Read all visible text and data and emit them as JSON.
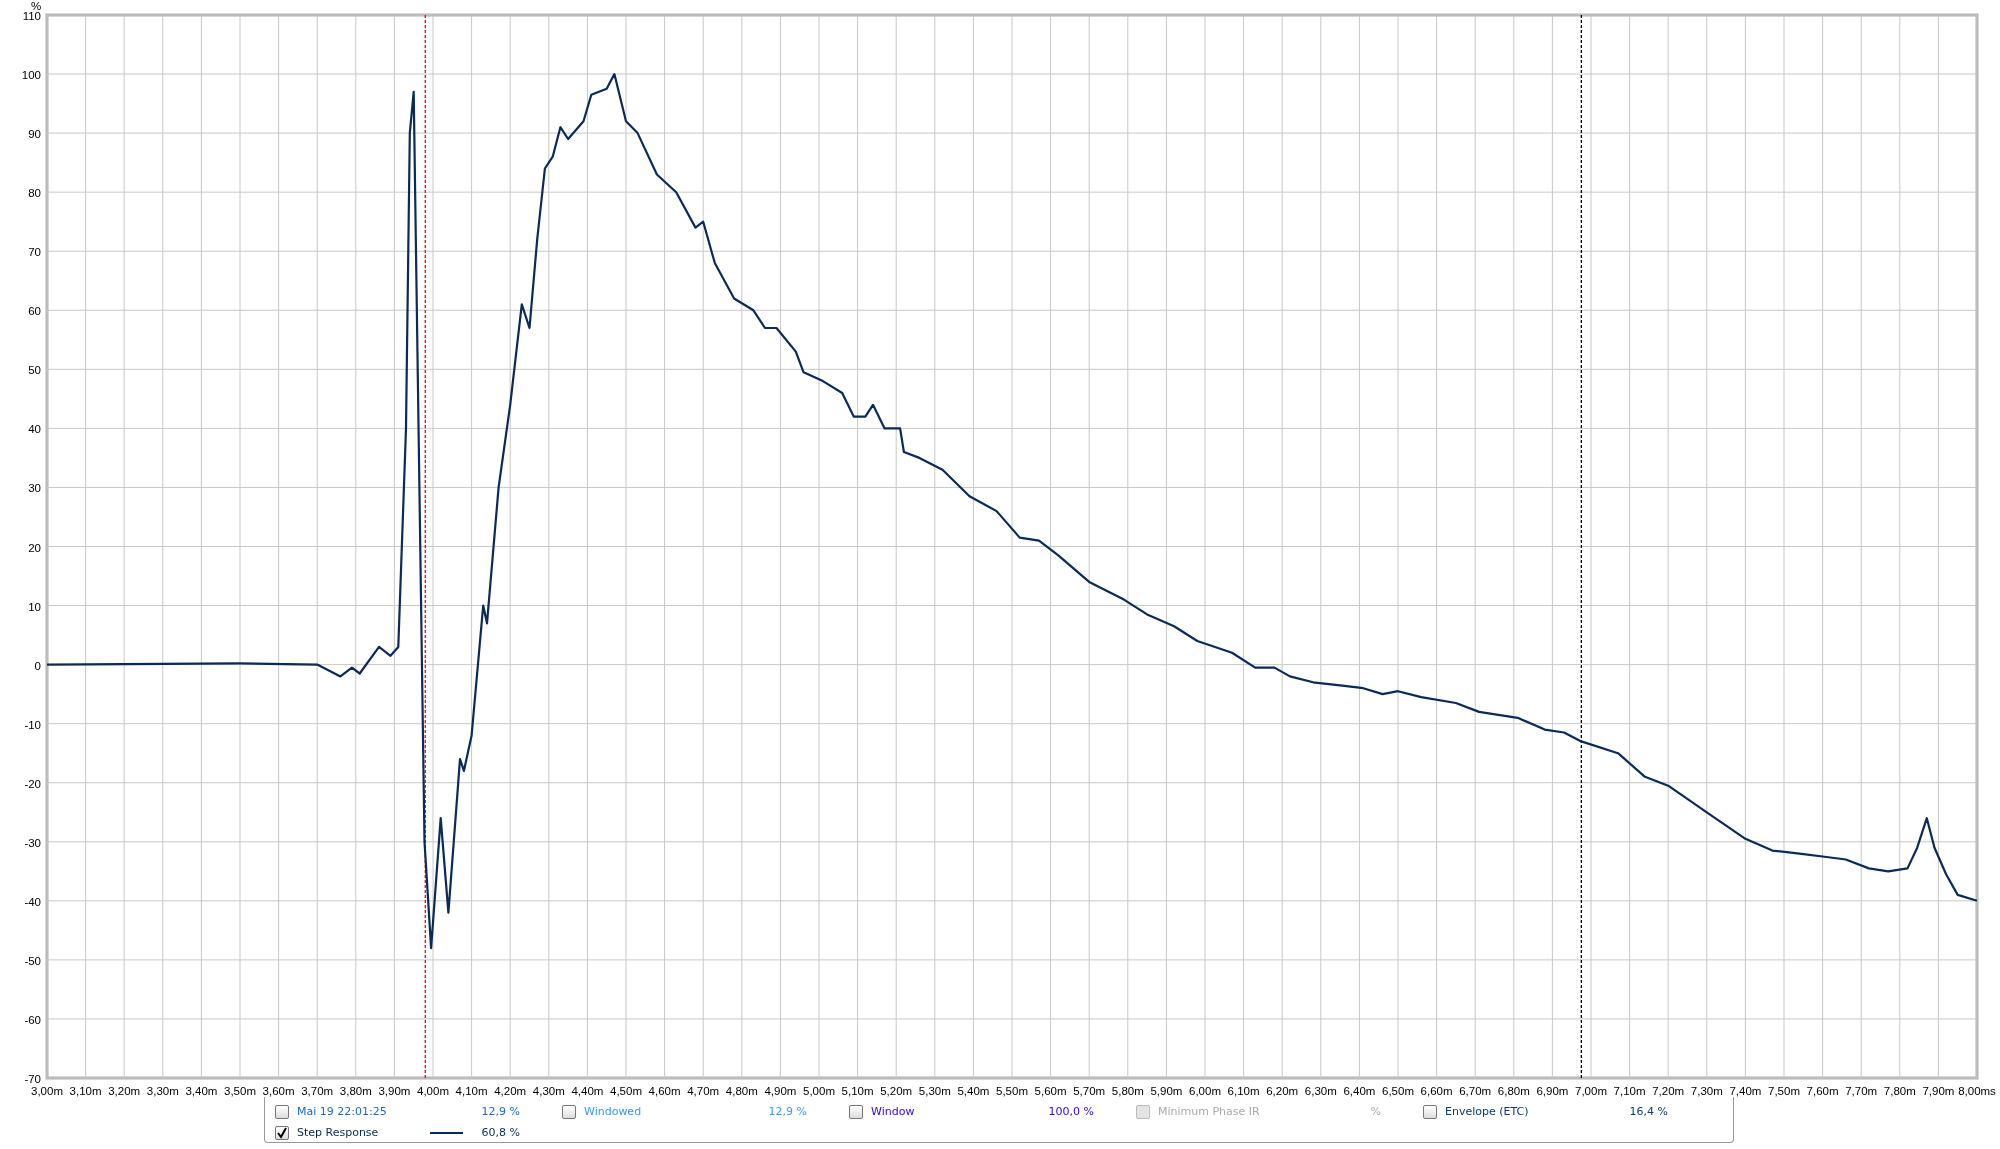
{
  "chart": {
    "chart_data": {
      "type": "line",
      "ylabel": "%",
      "xlim": [
        3.0,
        8.0
      ],
      "ylim": [
        -70,
        110
      ],
      "yticks": [
        -70,
        -60,
        -50,
        -40,
        -30,
        -20,
        -10,
        0,
        10,
        20,
        30,
        40,
        50,
        60,
        70,
        80,
        90,
        100,
        110
      ],
      "xticks": [
        {
          "value": 3.0,
          "label": "3,00m"
        },
        {
          "value": 3.1,
          "label": "3,10m"
        },
        {
          "value": 3.2,
          "label": "3,20m"
        },
        {
          "value": 3.3,
          "label": "3,30m"
        },
        {
          "value": 3.4,
          "label": "3,40m"
        },
        {
          "value": 3.5,
          "label": "3,50m"
        },
        {
          "value": 3.6,
          "label": "3,60m"
        },
        {
          "value": 3.7,
          "label": "3,70m"
        },
        {
          "value": 3.8,
          "label": "3,80m"
        },
        {
          "value": 3.9,
          "label": "3,90m"
        },
        {
          "value": 4.0,
          "label": "4,00m"
        },
        {
          "value": 4.1,
          "label": "4,10m"
        },
        {
          "value": 4.2,
          "label": "4,20m"
        },
        {
          "value": 4.3,
          "label": "4,30m"
        },
        {
          "value": 4.4,
          "label": "4,40m"
        },
        {
          "value": 4.5,
          "label": "4,50m"
        },
        {
          "value": 4.6,
          "label": "4,60m"
        },
        {
          "value": 4.7,
          "label": "4,70m"
        },
        {
          "value": 4.8,
          "label": "4,80m"
        },
        {
          "value": 4.9,
          "label": "4,90m"
        },
        {
          "value": 5.0,
          "label": "5,00m"
        },
        {
          "value": 5.1,
          "label": "5,10m"
        },
        {
          "value": 5.2,
          "label": "5,20m"
        },
        {
          "value": 5.3,
          "label": "5,30m"
        },
        {
          "value": 5.4,
          "label": "5,40m"
        },
        {
          "value": 5.5,
          "label": "5,50m"
        },
        {
          "value": 5.6,
          "label": "5,60m"
        },
        {
          "value": 5.7,
          "label": "5,70m"
        },
        {
          "value": 5.8,
          "label": "5,80m"
        },
        {
          "value": 5.9,
          "label": "5,90m"
        },
        {
          "value": 6.0,
          "label": "6,00m"
        },
        {
          "value": 6.1,
          "label": "6,10m"
        },
        {
          "value": 6.2,
          "label": "6,20m"
        },
        {
          "value": 6.3,
          "label": "6,30m"
        },
        {
          "value": 6.4,
          "label": "6,40m"
        },
        {
          "value": 6.5,
          "label": "6,50m"
        },
        {
          "value": 6.6,
          "label": "6,60m"
        },
        {
          "value": 6.7,
          "label": "6,70m"
        },
        {
          "value": 6.8,
          "label": "6,80m"
        },
        {
          "value": 6.9,
          "label": "6,90m"
        },
        {
          "value": 7.0,
          "label": "7,00m"
        },
        {
          "value": 7.1,
          "label": "7,10m"
        },
        {
          "value": 7.2,
          "label": "7,20m"
        },
        {
          "value": 7.3,
          "label": "7,30m"
        },
        {
          "value": 7.4,
          "label": "7,40m"
        },
        {
          "value": 7.5,
          "label": "7,50m"
        },
        {
          "value": 7.6,
          "label": "7,60m"
        },
        {
          "value": 7.7,
          "label": "7,70m"
        },
        {
          "value": 7.8,
          "label": "7,80m"
        },
        {
          "value": 7.9,
          "label": "7,90m"
        },
        {
          "value": 8.0,
          "label": "8,00ms"
        }
      ],
      "x": [
        3.0,
        3.5,
        3.7,
        3.76,
        3.79,
        3.81,
        3.86,
        3.89,
        3.91,
        3.93,
        3.94,
        3.95,
        3.978,
        3.995,
        4.02,
        4.04,
        4.07,
        4.08,
        4.1,
        4.13,
        4.14,
        4.17,
        4.2,
        4.23,
        4.25,
        4.27,
        4.29,
        4.31,
        4.33,
        4.35,
        4.39,
        4.41,
        4.45,
        4.47,
        4.5,
        4.53,
        4.58,
        4.63,
        4.68,
        4.7,
        4.73,
        4.78,
        4.83,
        4.86,
        4.89,
        4.94,
        4.96,
        5.01,
        5.06,
        5.09,
        5.12,
        5.14,
        5.17,
        5.21,
        5.22,
        5.26,
        5.32,
        5.39,
        5.46,
        5.52,
        5.57,
        5.62,
        5.7,
        5.79,
        5.85,
        5.92,
        5.98,
        6.07,
        6.13,
        6.18,
        6.22,
        6.28,
        6.35,
        6.41,
        6.46,
        6.5,
        6.56,
        6.65,
        6.71,
        6.81,
        6.88,
        6.93,
        6.975,
        7.07,
        7.14,
        7.2,
        7.3,
        7.4,
        7.47,
        7.54,
        7.6,
        7.66,
        7.72,
        7.77,
        7.82,
        7.845,
        7.87,
        7.89,
        7.92,
        7.95,
        8.0
      ],
      "series": [
        {
          "color": "#0a2a5a",
          "values": [
            0,
            0.2,
            0,
            -2,
            -0.5,
            -1.5,
            3,
            1.5,
            3,
            40,
            90,
            97,
            -30,
            -48,
            -26,
            -42,
            -16,
            -18,
            -12,
            10,
            7,
            30,
            44,
            61,
            57,
            72,
            84,
            86,
            91,
            89,
            92,
            96.5,
            97.5,
            100,
            92,
            90,
            83,
            80,
            74,
            75,
            68,
            62,
            60,
            57,
            57,
            53,
            49.5,
            48,
            46,
            42,
            42,
            44,
            40,
            40,
            36,
            35,
            33,
            28.5,
            26,
            21.5,
            21,
            18.5,
            14,
            11,
            8.5,
            6.5,
            4,
            2,
            -0.5,
            -0.5,
            -2,
            -3,
            -3.5,
            -4,
            -5,
            -4.5,
            -5.5,
            -6.5,
            -8,
            -9,
            -11,
            -11.5,
            -13,
            -15,
            -19,
            -20.5,
            -25,
            -29.5,
            -31.5,
            -32,
            -32.5,
            -33,
            -34.5,
            -35,
            -34.5,
            -31,
            -26,
            -31,
            -35.5,
            -39,
            -40
          ]
        }
      ],
      "grid": true,
      "ref_lines": [
        {
          "axis": "x",
          "value": 3.98,
          "color": "#ff0000"
        },
        {
          "axis": "x",
          "value": 6.975,
          "color": "#000000"
        }
      ]
    }
  },
  "legend": {
    "rows": [
      [
        {
          "label": "Mai 19 22:01:25",
          "checked": false,
          "disabled": false,
          "color": "#1a6ad0",
          "value": "12,9 %",
          "swatch": false
        },
        {
          "label": "Windowed",
          "checked": false,
          "disabled": false,
          "color": "#3399ff",
          "value": "12,9 %",
          "swatch": false
        },
        {
          "label": "Window",
          "checked": false,
          "disabled": false,
          "color": "#3300ff",
          "value": "100,0 %",
          "swatch": false
        },
        {
          "label": "Minimum Phase IR",
          "checked": false,
          "disabled": true,
          "color": "#aaaaaa",
          "value": "%",
          "swatch": false
        },
        {
          "label": "Envelope (ETC)",
          "checked": false,
          "disabled": false,
          "color": "#0a3a80",
          "value": "16,4 %",
          "swatch": false
        }
      ],
      [
        {
          "label": "Step Response",
          "checked": true,
          "disabled": false,
          "color": "#0a2a5a",
          "value": "60,8 %",
          "swatch": true
        }
      ]
    ]
  }
}
